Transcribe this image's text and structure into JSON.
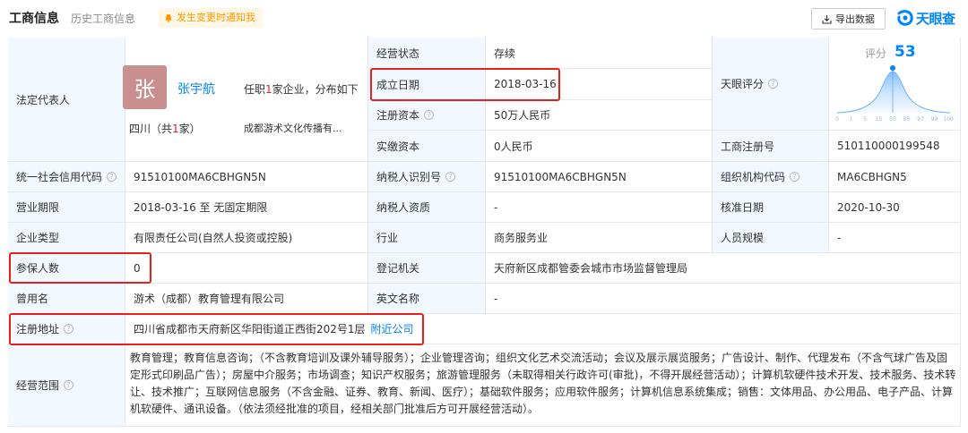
{
  "header": {
    "title": "工商信息",
    "tab_history": "历史工商信息",
    "notify_label": "发生变更时通知我",
    "export_label": "导出数据",
    "logo_text": "天眼查"
  },
  "rows": {
    "legal_rep_label": "法定代表人",
    "avatar_char": "张",
    "rep_name": "张宇航",
    "rep_info_prefix": "任职",
    "rep_info_count": "1",
    "rep_info_suffix": "家企业，分布如下",
    "rep_area_prefix": "四川（共",
    "rep_area_count": "1",
    "rep_area_suffix": "家）",
    "rep_company": "成都游术文化传播有...",
    "status_label": "经营状态",
    "status_value": "存续",
    "founded_label": "成立日期",
    "founded_value": "2018-03-16",
    "reg_capital_label": "注册资本",
    "reg_capital_value": "50万人民币",
    "paid_capital_label": "实缴资本",
    "paid_capital_value": "0人民币",
    "score_label": "天眼评分",
    "biz_reg_no_label": "工商注册号",
    "biz_reg_no_value": "510110000199548",
    "credit_code_label": "统一社会信用代码",
    "credit_code_value": "91510100MA6CBHGN5N",
    "taxpayer_id_label": "纳税人识别号",
    "taxpayer_id_value": "91510100MA6CBHGN5N",
    "org_code_label": "组织机构代码",
    "org_code_value": "MA6CBHGN5",
    "term_label": "营业期限",
    "term_value": "2018-03-16 至 无固定期限",
    "taxpayer_qual_label": "纳税人资质",
    "taxpayer_qual_value": "-",
    "approval_label": "核准日期",
    "approval_value": "2020-10-30",
    "type_label": "企业类型",
    "type_value": "有限责任公司(自然人投资或控股)",
    "industry_label": "行业",
    "industry_value": "商务服务业",
    "staff_label": "人员规模",
    "staff_value": "-",
    "insured_label": "参保人数",
    "insured_value": "0",
    "authority_label": "登记机关",
    "authority_value": "天府新区成都管委会城市市场监督管理局",
    "former_name_label": "曾用名",
    "former_name_value": "游术（成都）教育管理有限公司",
    "english_name_label": "英文名称",
    "english_name_value": "-",
    "address_label": "注册地址",
    "address_value": "四川省成都市天府新区华阳街道正西街202号1层",
    "nearby_link": "附近公司",
    "scope_label": "经营范围",
    "scope_value": "教育管理；教育信息咨询；（不含教育培训及课外辅导服务）；企业管理咨询；组织文化艺术交流活动；会议及展示展览服务；广告设计、制作、代理发布（不含气球广告及固定形式印刷品广告）；房屋中介服务；市场调查；知识产权服务；旅游管理服务（未取得相关行政许可(审批)，不得开展经营活动）；计算机软硬件技术开发、技术服务、技术转让、技术推广；互联网信息服务（不含金融、证券、教育、新闻、医疗）；基础软件服务；应用软件服务；计算机信息系统集成；销售：文体用品、办公用品、电子产品、计算机软硬件、通讯设备。（依法须经批准的项目，经相关部门批准后方可开展经营活动）。"
  },
  "score": {
    "label": "评分",
    "value": "53",
    "value_numeric": 53,
    "ticks": [
      "0",
      "1",
      "5",
      "15",
      "50",
      "85",
      "97",
      "99",
      "100"
    ]
  },
  "colors": {
    "accent": "#0084ff",
    "label_bg": "#f2f8ff",
    "highlight_red": "#e6211c",
    "notify_orange": "#ff9800"
  }
}
